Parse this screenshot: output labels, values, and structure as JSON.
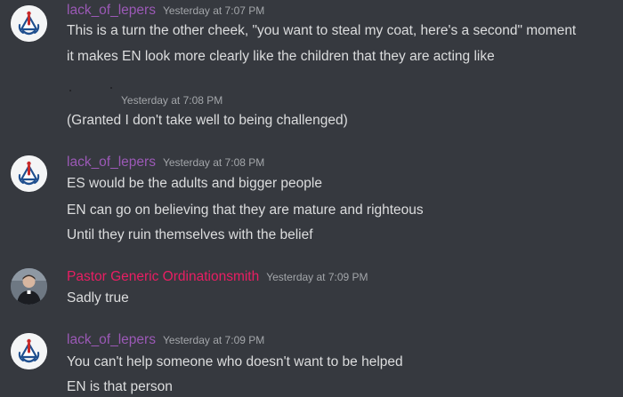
{
  "colors": {
    "background": "#36393f",
    "text": "#dcddde",
    "timestamp": "#a3a6aa",
    "username_purple": "#9b59b6",
    "username_pink": "#e91e63"
  },
  "messages": [
    {
      "username": "lack_of_lepers",
      "timestamp": "Yesterday at 7:07 PM",
      "lines": [
        "This is a turn the other cheek, \"you want to steal my coat, here's a second\" moment",
        "it makes EN look more clearly like the children that they are acting like"
      ]
    },
    {
      "username": "",
      "timestamp": "Yesterday at 7:08 PM",
      "lines": [
        "(Granted I don't take well to being challenged)"
      ]
    },
    {
      "username": "lack_of_lepers",
      "timestamp": "Yesterday at 7:08 PM",
      "lines": [
        "ES would be the adults and bigger people",
        "EN can go on believing that they are mature and righteous",
        "Until they ruin themselves with the belief"
      ]
    },
    {
      "username": "Pastor Generic Ordinationsmith",
      "timestamp": "Yesterday at 7:09 PM",
      "lines": [
        "Sadly true"
      ]
    },
    {
      "username": "lack_of_lepers",
      "timestamp": "Yesterday at 7:09 PM",
      "lines": [
        "You can't help someone who doesn't want to be helped",
        "EN is that person"
      ]
    }
  ]
}
